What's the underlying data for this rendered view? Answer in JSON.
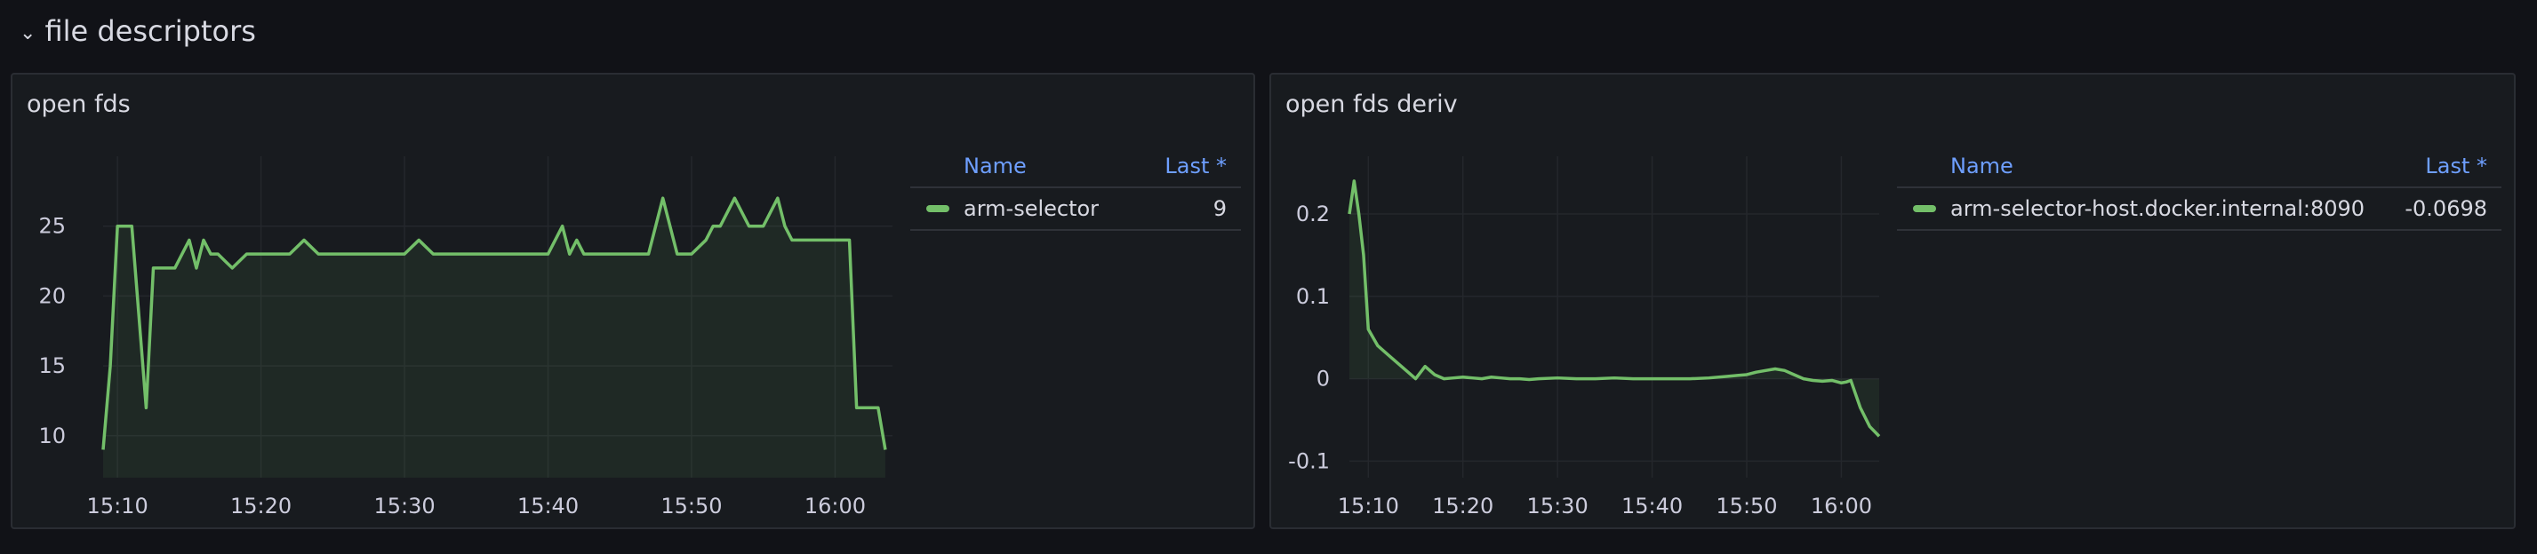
{
  "row": {
    "title": "file descriptors",
    "chevron_icon": "chevron-down-icon"
  },
  "colors": {
    "series": "#73bf69",
    "legend_header": "#6e9fff",
    "background": "#111217",
    "panel": "#181b1f"
  },
  "panels": [
    {
      "title": "open fds",
      "legend": {
        "name_header": "Name",
        "last_header": "Last *",
        "series_name": "arm-selector",
        "last_value": "9"
      }
    },
    {
      "title": "open fds deriv",
      "legend": {
        "name_header": "Name",
        "last_header": "Last *",
        "series_name": "arm-selector-host.docker.internal:8090",
        "last_value": "-0.0698"
      }
    }
  ],
  "chart_data": [
    {
      "type": "area",
      "title": "open fds",
      "xlim": [
        "15:09",
        "16:04"
      ],
      "ylim": [
        7,
        30
      ],
      "x_ticks": [
        "15:10",
        "15:20",
        "15:30",
        "15:40",
        "15:50",
        "16:00"
      ],
      "y_ticks": [
        10,
        15,
        20,
        25
      ],
      "grid": true,
      "legend_placement": "right",
      "series": [
        {
          "name": "arm-selector",
          "x": [
            "15:09",
            "15:09.5",
            "15:10",
            "15:11",
            "15:12",
            "15:12.5",
            "15:13",
            "15:14",
            "15:15",
            "15:15.5",
            "15:16",
            "15:16.5",
            "15:17",
            "15:18",
            "15:19",
            "15:20",
            "15:21",
            "15:22",
            "15:23",
            "15:24",
            "15:25",
            "15:26",
            "15:27",
            "15:28",
            "15:29",
            "15:30",
            "15:31",
            "15:32",
            "15:33",
            "15:34",
            "15:35",
            "15:36",
            "15:37",
            "15:38",
            "15:39",
            "15:40",
            "15:41",
            "15:41.5",
            "15:42",
            "15:42.5",
            "15:43",
            "15:44",
            "15:45",
            "15:46",
            "15:47",
            "15:48",
            "15:49",
            "15:49.5",
            "15:50",
            "15:51",
            "15:51.5",
            "15:52",
            "15:53",
            "15:54",
            "15:54.5",
            "15:55",
            "15:56",
            "15:56.5",
            "15:57",
            "15:58",
            "15:59",
            "16:00",
            "16:01",
            "16:01.5",
            "16:02",
            "16:03",
            "16:03.5"
          ],
          "values": [
            9,
            15,
            25,
            25,
            12,
            22,
            22,
            22,
            24,
            22,
            24,
            23,
            23,
            22,
            23,
            23,
            23,
            23,
            24,
            23,
            23,
            23,
            23,
            23,
            23,
            23,
            24,
            23,
            23,
            23,
            23,
            23,
            23,
            23,
            23,
            23,
            25,
            23,
            24,
            23,
            23,
            23,
            23,
            23,
            23,
            27,
            23,
            23,
            23,
            24,
            25,
            25,
            27,
            25,
            25,
            25,
            27,
            25,
            24,
            24,
            24,
            24,
            24,
            12,
            12,
            12,
            9
          ]
        }
      ]
    },
    {
      "type": "area",
      "title": "open fds deriv",
      "xlim": [
        "15:08",
        "16:04"
      ],
      "ylim": [
        -0.12,
        0.27
      ],
      "x_ticks": [
        "15:10",
        "15:20",
        "15:30",
        "15:40",
        "15:50",
        "16:00"
      ],
      "y_ticks": [
        -0.1,
        0,
        0.1,
        0.2
      ],
      "grid": true,
      "legend_placement": "right",
      "series": [
        {
          "name": "arm-selector-host.docker.internal:8090",
          "x": [
            "15:08",
            "15:08.5",
            "15:09",
            "15:09.5",
            "15:10",
            "15:11",
            "15:12",
            "15:13",
            "15:14",
            "15:15",
            "15:16",
            "15:17",
            "15:18",
            "15:19",
            "15:20",
            "15:21",
            "15:22",
            "15:23",
            "15:24",
            "15:25",
            "15:26",
            "15:27",
            "15:28",
            "15:30",
            "15:32",
            "15:34",
            "15:36",
            "15:38",
            "15:40",
            "15:42",
            "15:44",
            "15:46",
            "15:48",
            "15:49",
            "15:50",
            "15:51",
            "15:52",
            "15:53",
            "15:54",
            "15:55",
            "15:56",
            "15:57",
            "15:58",
            "15:59",
            "16:00",
            "16:00.5",
            "16:01",
            "16:02",
            "16:03",
            "16:04"
          ],
          "values": [
            0.2,
            0.24,
            0.2,
            0.15,
            0.06,
            0.04,
            0.03,
            0.02,
            0.01,
            0.0,
            0.015,
            0.005,
            0.0,
            0.001,
            0.002,
            0.001,
            0.0,
            0.002,
            0.001,
            0.0,
            0.0,
            -0.001,
            0.0,
            0.001,
            0.0,
            0.0,
            0.001,
            0.0,
            0.0,
            0.0,
            0.0,
            0.001,
            0.003,
            0.004,
            0.005,
            0.008,
            0.01,
            0.012,
            0.01,
            0.005,
            0.0,
            -0.002,
            -0.003,
            -0.002,
            -0.005,
            -0.004,
            -0.002,
            -0.035,
            -0.058,
            -0.0698
          ]
        }
      ]
    }
  ]
}
